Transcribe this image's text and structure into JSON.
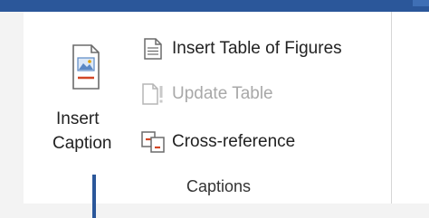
{
  "ribbon": {
    "insert_caption": {
      "line1": "Insert",
      "line2": "Caption",
      "icon": "insert-caption-icon"
    },
    "insert_table_of_figures": {
      "label": "Insert Table of Figures",
      "icon": "table-of-figures-icon"
    },
    "update_table": {
      "label": "Update Table",
      "icon": "update-table-icon",
      "disabled": true
    },
    "cross_reference": {
      "label": "Cross-reference",
      "icon": "cross-reference-icon"
    },
    "group_name": "Captions"
  },
  "colors": {
    "title_bar": "#2b579a",
    "accent_red": "#d24726",
    "disabled_text": "#a8a8a8"
  }
}
